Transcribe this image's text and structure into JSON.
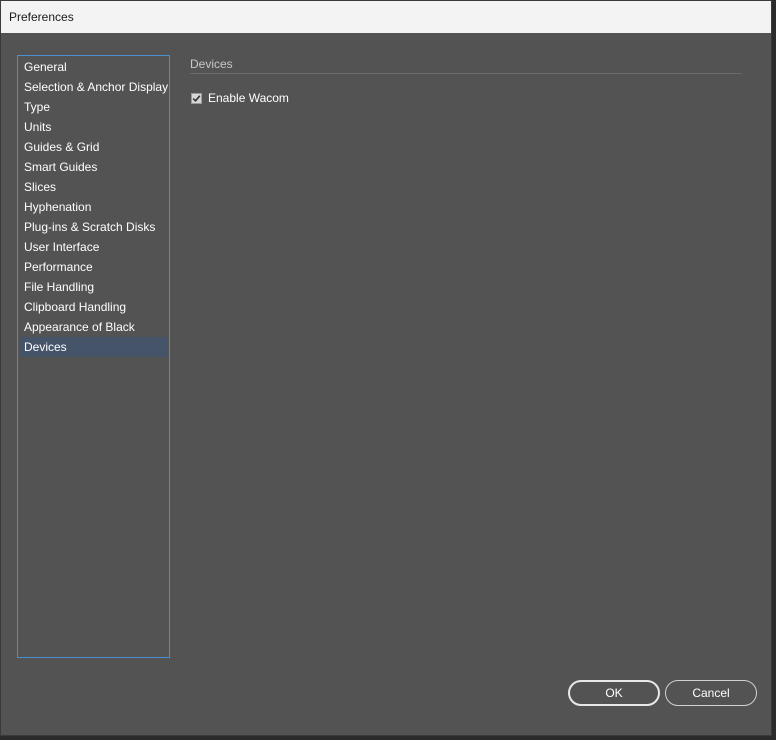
{
  "window": {
    "title": "Preferences"
  },
  "sidebar": {
    "items": [
      {
        "label": "General"
      },
      {
        "label": "Selection & Anchor Display"
      },
      {
        "label": "Type"
      },
      {
        "label": "Units"
      },
      {
        "label": "Guides & Grid"
      },
      {
        "label": "Smart Guides"
      },
      {
        "label": "Slices"
      },
      {
        "label": "Hyphenation"
      },
      {
        "label": "Plug-ins & Scratch Disks"
      },
      {
        "label": "User Interface"
      },
      {
        "label": "Performance"
      },
      {
        "label": "File Handling"
      },
      {
        "label": "Clipboard Handling"
      },
      {
        "label": "Appearance of Black"
      },
      {
        "label": "Devices"
      }
    ],
    "selected_index": 14
  },
  "content": {
    "section_title": "Devices",
    "enable_wacom": {
      "label": "Enable Wacom",
      "checked": true
    }
  },
  "buttons": {
    "ok_label": "OK",
    "cancel_label": "Cancel"
  },
  "colors": {
    "panel_bg": "#535353",
    "selection_bg": "#46546a",
    "sidebar_border": "#4a8fd4"
  }
}
